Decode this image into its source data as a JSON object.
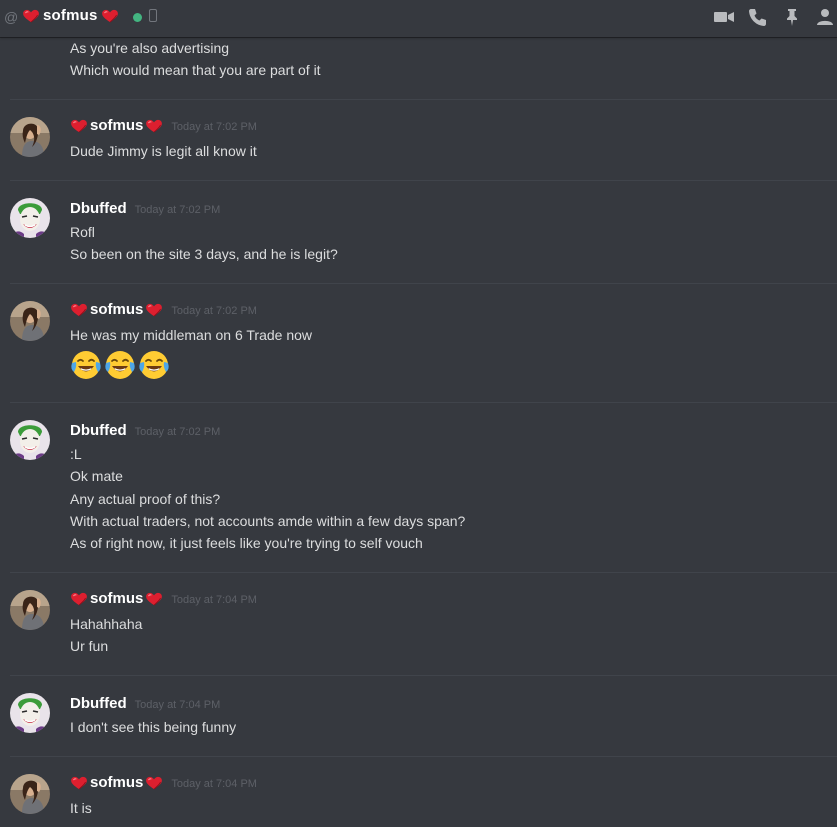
{
  "header": {
    "at_symbol": "@",
    "channel_name": "sofmus",
    "status": "online",
    "icons": [
      "video-camera-icon",
      "phone-icon",
      "pin-icon",
      "members-icon"
    ]
  },
  "colors": {
    "background": "#36393f",
    "text": "#dcddde",
    "username": "#ffffff",
    "timestamp": "#5d6067",
    "heart": "#e0142c",
    "online": "#43b581"
  },
  "messages": {
    "top_continuation": [
      "As you're also advertising",
      "Which would mean that you are part of it"
    ],
    "g1": {
      "author": "sofmus",
      "timestamp": "Today at 7:02 PM",
      "lines": [
        "Dude Jimmy is legit all know it"
      ]
    },
    "g2": {
      "author": "Dbuffed",
      "timestamp": "Today at 7:02 PM",
      "lines": [
        "Rofl",
        "So been on the site 3 days, and he is legit?"
      ]
    },
    "g3": {
      "author": "sofmus",
      "timestamp": "Today at 7:02 PM",
      "lines": [
        "He was my middleman on 6 Trade now"
      ],
      "emojis": [
        "joy-emoji",
        "joy-emoji",
        "joy-emoji"
      ]
    },
    "g4": {
      "author": "Dbuffed",
      "timestamp": "Today at 7:02 PM",
      "lines": [
        ":L",
        "Ok mate",
        "Any actual proof of this?",
        "With actual traders, not accounts amde within a few days span?",
        "As of right now, it just feels like you're trying to self vouch"
      ]
    },
    "g5": {
      "author": "sofmus",
      "timestamp": "Today at 7:04 PM",
      "lines": [
        "Hahahhaha",
        "Ur fun"
      ]
    },
    "g6": {
      "author": "Dbuffed",
      "timestamp": "Today at 7:04 PM",
      "lines": [
        "I don't see this being funny"
      ]
    },
    "g7": {
      "author": "sofmus",
      "timestamp": "Today at 7:04 PM",
      "lines": [
        "It is"
      ]
    }
  }
}
